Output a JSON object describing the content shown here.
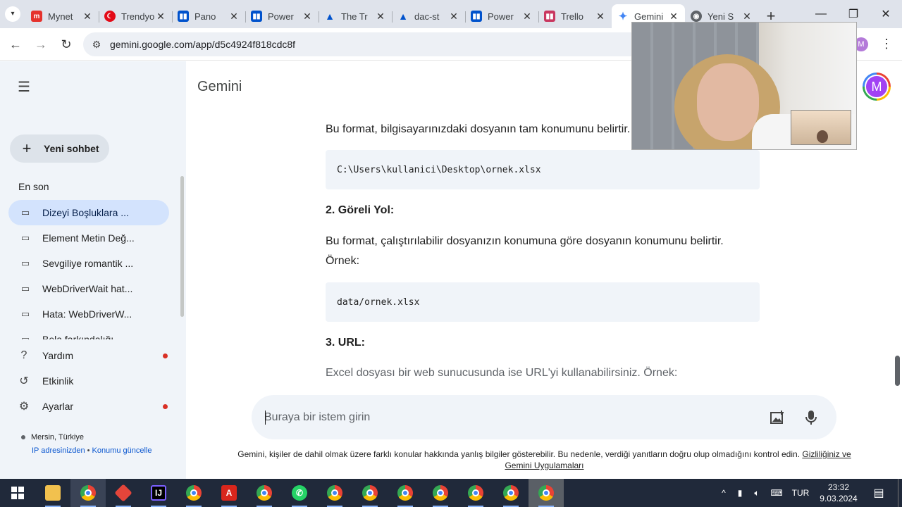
{
  "browser": {
    "tabs": [
      {
        "label": "Mynet",
        "icon": "mynet-favicon",
        "color": "#e5322d"
      },
      {
        "label": "Trendyol",
        "icon": "turkish-flag-favicon",
        "color": "#e30a17"
      },
      {
        "label": "Pano",
        "icon": "trello-favicon",
        "color": "#0052cc"
      },
      {
        "label": "Power",
        "icon": "trello-favicon",
        "color": "#0052cc"
      },
      {
        "label": "The Tr",
        "icon": "atlassian-favicon",
        "color": "#0052cc"
      },
      {
        "label": "dac-st",
        "icon": "atlassian-favicon",
        "color": "#0052cc"
      },
      {
        "label": "Power",
        "icon": "trello-favicon",
        "color": "#0052cc"
      },
      {
        "label": "Trello",
        "icon": "trello-favicon",
        "color": "#c9375f"
      },
      {
        "label": "Gemini",
        "icon": "gemini-favicon",
        "color": "#4285f4",
        "active": true
      },
      {
        "label": "Yeni S",
        "icon": "chrome-favicon",
        "color": "#5f6368"
      }
    ],
    "url": "gemini.google.com/app/d5c4924f818cdc8f",
    "profile_initial": "M"
  },
  "sidebar": {
    "new_chat": "Yeni sohbet",
    "recent_heading": "En son",
    "recent": [
      "Dizeyi Boşluklara ...",
      "Element Metin Değ...",
      "Sevgiliye romantik ...",
      "WebDriverWait hat...",
      "Hata: WebDriverW...",
      "Bela farkındalığı..."
    ],
    "help": "Yardım",
    "activity": "Etkinlik",
    "settings": "Ayarlar",
    "location": "Mersin, Türkiye",
    "location_link_1": "IP adresinizden",
    "location_link_2": "Konumu güncelle"
  },
  "main": {
    "brand": "Gemini",
    "avatar_initial": "M",
    "para1": "Bu format, bilgisayarınızdaki dosyanın tam konumunu belirtir. Örnek:",
    "code1": "C:\\Users\\kullanici\\Desktop\\ornek.xlsx",
    "heading2": "2. Göreli Yol:",
    "para2_line1": "Bu format, çalıştırılabilir dosyanızın konumuna göre dosyanın konumunu belirtir.",
    "para2_line2": "Örnek:",
    "code2": "data/ornek.xlsx",
    "heading3": "3. URL:",
    "para3": "Excel dosyası bir web sunucusunda ise URL'yi kullanabilirsiniz. Örnek:"
  },
  "prompt": {
    "placeholder": "Buraya bir istem girin",
    "disclaimer": "Gemini, kişiler de dahil olmak üzere farklı konular hakkında yanlış bilgiler gösterebilir. Bu nedenle, verdiği yanıtların doğru olup olmadığını kontrol edin.",
    "disclaimer_link": "Gizliliğiniz ve Gemini Uygulamaları"
  },
  "taskbar": {
    "language": "TUR",
    "time": "23:32",
    "date": "9.03.2024"
  },
  "colors": {
    "sidebar_bg": "#f0f4f9",
    "active_item": "#d3e3fd",
    "link": "#0b57d0",
    "alert_dot": "#d93025",
    "taskbar_bg": "#20293a"
  }
}
